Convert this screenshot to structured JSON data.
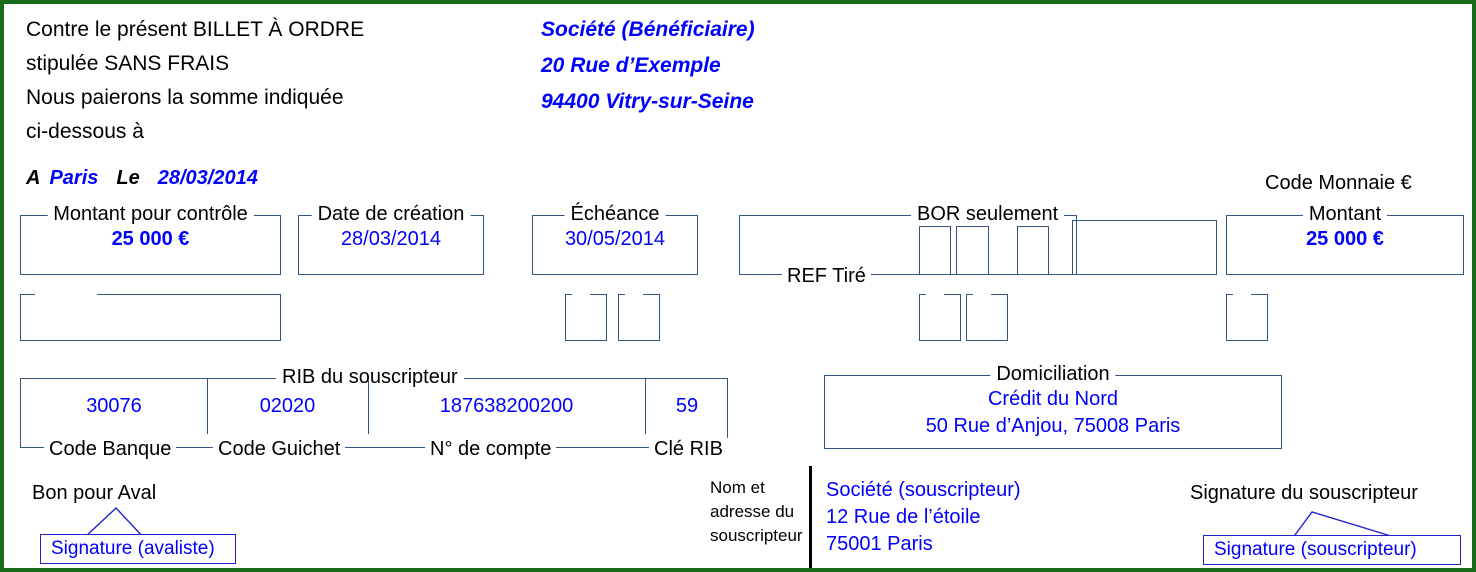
{
  "document": {
    "kind": "billet-a-ordre",
    "border_color": "#1a6b1a",
    "box_color": "#31567f",
    "value_color": "#0000ff"
  },
  "header": {
    "lines": [
      "Contre le présent BILLET À ORDRE",
      "stipulée SANS FRAIS",
      "Nous paierons la somme indiquée",
      "ci-dessous à"
    ],
    "beneficiary": [
      "Société (Bénéficiaire)",
      "20 Rue d’Exemple",
      "94400 Vitry-sur-Seine"
    ],
    "place_prefix": "A",
    "place": "Paris",
    "date_prefix": "Le",
    "date": "28/03/2014",
    "currency_code_label": "Code Monnaie €"
  },
  "fields": {
    "montant_controle": {
      "label": "Montant pour contrôle",
      "value": "25 000 €"
    },
    "date_creation": {
      "label": "Date de création",
      "value": "28/03/2014"
    },
    "echeance": {
      "label": "Échéance",
      "value": "30/05/2014"
    },
    "bor_seulement": {
      "label": "BOR seulement",
      "value": ""
    },
    "ref_tire": {
      "label": "REF Tiré",
      "value": ""
    },
    "montant": {
      "label": "Montant",
      "value": "25 000 €"
    }
  },
  "rib": {
    "title": "RIB du souscripteur",
    "columns": [
      {
        "label": "Code Banque",
        "value": "30076"
      },
      {
        "label": "Code Guichet",
        "value": "02020"
      },
      {
        "label": "N° de compte",
        "value": "187638200200"
      },
      {
        "label": "Clé RIB",
        "value": "59"
      }
    ]
  },
  "domiciliation": {
    "label": "Domiciliation",
    "lines": [
      "Crédit du Nord",
      "50 Rue d’Anjou, 75008 Paris"
    ]
  },
  "footer": {
    "aval_label": "Bon pour Aval",
    "aval_signature": "Signature (avaliste)",
    "subscriber_name_label": [
      "Nom et",
      "adresse du",
      "souscripteur"
    ],
    "subscriber_address": [
      "Société (souscripteur)",
      "12 Rue de l’étoile",
      "75001 Paris"
    ],
    "subscriber_signature_label": "Signature du souscripteur",
    "subscriber_signature": "Signature (souscripteur)"
  }
}
